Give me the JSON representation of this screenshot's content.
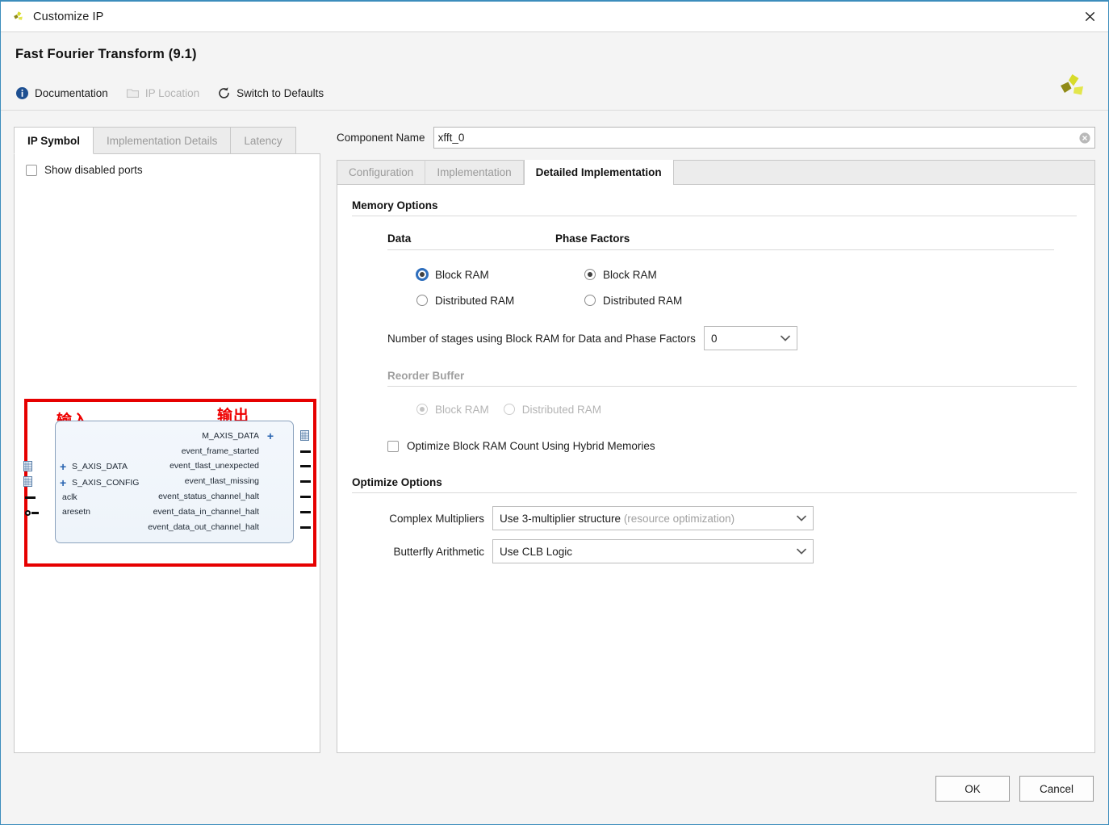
{
  "window": {
    "title": "Customize IP",
    "app_icon": "xilinx-logo-icon",
    "close_icon": "close-icon"
  },
  "header": {
    "title": "Fast Fourier Transform (9.1)",
    "logo_icon": "xilinx-logo-icon",
    "toolbar": [
      {
        "label": "Documentation",
        "icon": "info-icon",
        "disabled": false
      },
      {
        "label": "IP Location",
        "icon": "folder-icon",
        "disabled": true
      },
      {
        "label": "Switch to Defaults",
        "icon": "refresh-icon",
        "disabled": false
      }
    ]
  },
  "left_panel": {
    "tabs": [
      {
        "label": "IP Symbol",
        "active": true
      },
      {
        "label": "Implementation Details",
        "active": false
      },
      {
        "label": "Latency",
        "active": false
      }
    ],
    "show_disabled_ports": {
      "label": "Show disabled ports",
      "checked": false
    },
    "symbol": {
      "annotation_input": "输入",
      "annotation_output": "输出",
      "highlight_color": "#e60000",
      "input_ports": [
        {
          "name": "S_AXIS_DATA",
          "type": "bus"
        },
        {
          "name": "S_AXIS_CONFIG",
          "type": "bus"
        },
        {
          "name": "aclk",
          "type": "pin"
        },
        {
          "name": "aresetn",
          "type": "pin-inverted"
        }
      ],
      "output_ports": [
        {
          "name": "M_AXIS_DATA",
          "type": "bus"
        },
        {
          "name": "event_frame_started",
          "type": "pin"
        },
        {
          "name": "event_tlast_unexpected",
          "type": "pin"
        },
        {
          "name": "event_tlast_missing",
          "type": "pin"
        },
        {
          "name": "event_status_channel_halt",
          "type": "pin"
        },
        {
          "name": "event_data_in_channel_halt",
          "type": "pin"
        },
        {
          "name": "event_data_out_channel_halt",
          "type": "pin"
        }
      ]
    }
  },
  "right_panel": {
    "component_name": {
      "label": "Component Name",
      "value": "xfft_0",
      "placeholder": "",
      "clear_icon": "clear-circle-icon"
    },
    "tabs": [
      {
        "label": "Configuration",
        "active": false
      },
      {
        "label": "Implementation",
        "active": false
      },
      {
        "label": "Detailed Implementation",
        "active": true
      }
    ],
    "memory_options": {
      "title": "Memory Options",
      "data": {
        "title": "Data",
        "options": [
          {
            "label": "Block RAM",
            "selected": true,
            "focused": true
          },
          {
            "label": "Distributed RAM",
            "selected": false,
            "focused": false
          }
        ]
      },
      "phase_factors": {
        "title": "Phase Factors",
        "options": [
          {
            "label": "Block RAM",
            "selected": true,
            "focused": false
          },
          {
            "label": "Distributed RAM",
            "selected": false,
            "focused": false
          }
        ]
      },
      "stages": {
        "label": "Number of stages using Block RAM for Data and Phase Factors",
        "value": "0"
      },
      "reorder_buffer": {
        "title": "Reorder Buffer",
        "disabled": true,
        "options": [
          {
            "label": "Block RAM",
            "selected": true
          },
          {
            "label": "Distributed RAM",
            "selected": false
          }
        ]
      },
      "optimize_bram": {
        "label": "Optimize Block RAM Count Using Hybrid Memories",
        "checked": false
      }
    },
    "optimize_options": {
      "title": "Optimize Options",
      "complex_multipliers": {
        "label": "Complex Multipliers",
        "value": "Use 3-multiplier structure",
        "value_hint": "(resource optimization)"
      },
      "butterfly_arithmetic": {
        "label": "Butterfly Arithmetic",
        "value": "Use CLB Logic",
        "value_hint": ""
      }
    }
  },
  "footer": {
    "ok_label": "OK",
    "cancel_label": "Cancel"
  }
}
